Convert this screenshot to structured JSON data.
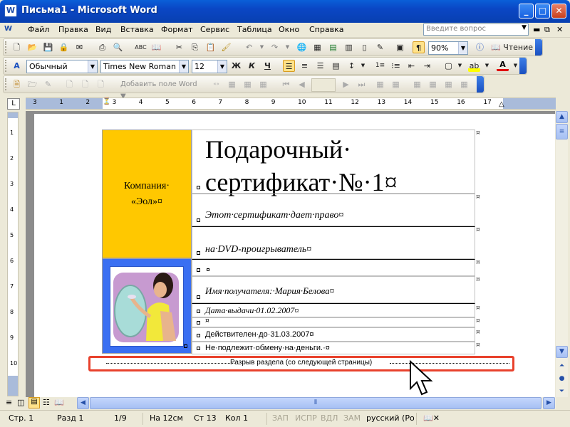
{
  "window": {
    "title": "Письма1 - Microsoft Word",
    "app_icon": "W"
  },
  "menu": [
    "Файл",
    "Правка",
    "Вид",
    "Вставка",
    "Формат",
    "Сервис",
    "Таблица",
    "Окно",
    "Справка"
  ],
  "help_box": {
    "placeholder": "Введите вопрос"
  },
  "toolbar_standard": {
    "zoom": "90%",
    "reading_label": "Чтение"
  },
  "toolbar_format": {
    "style": "Обычный",
    "font": "Times New Roman",
    "size": "12",
    "bold": "Ж",
    "italic": "К",
    "underline": "Ч"
  },
  "toolbar_mailmerge": {
    "add_field": "Добавить поле Word"
  },
  "ruler": {
    "marks": [
      "3",
      "1",
      "2",
      "3",
      "4",
      "5",
      "6",
      "7",
      "8",
      "9",
      "10",
      "11",
      "12",
      "13",
      "14",
      "15",
      "16",
      "17"
    ]
  },
  "vruler": {
    "marks": [
      "1",
      "2",
      "3",
      "4",
      "5",
      "6",
      "7",
      "8",
      "9",
      "10"
    ]
  },
  "document": {
    "company_line1": "Компания·",
    "company_line2": "«Эол»¤",
    "title_line1": "Подарочный·",
    "title_line2": "сертификат·№·1¤",
    "right_line1": "Этот·сертификат·дает·право¤",
    "right_line2": "на·DVD-проигрыватель¤",
    "recipient": "Имя·получателя:·Мария·Белова¤",
    "issue_date": "Дата·выдачи·01.02.2007¤",
    "blank_mark": "¤",
    "valid_until": "Действителен·до·31.03.2007¤",
    "no_exchange": "Не·подлежит·обмену·на·деньги.·¤",
    "section_break": "Разрыв раздела (со следующей страницы)"
  },
  "status": {
    "page": "Стр.  1",
    "section": "Разд  1",
    "pages": "1/9",
    "at": "На  12см",
    "line": "Ст  13",
    "col": "Кол  1",
    "rec": "ЗАП",
    "trk": "ИСПР",
    "ext": "ВДЛ",
    "ovr": "ЗАМ",
    "lang": "русский (Ро"
  },
  "colors": {
    "company_cell": "#ffc800",
    "image_frame": "#3a6ff2",
    "highlight_border": "#e8412c"
  }
}
